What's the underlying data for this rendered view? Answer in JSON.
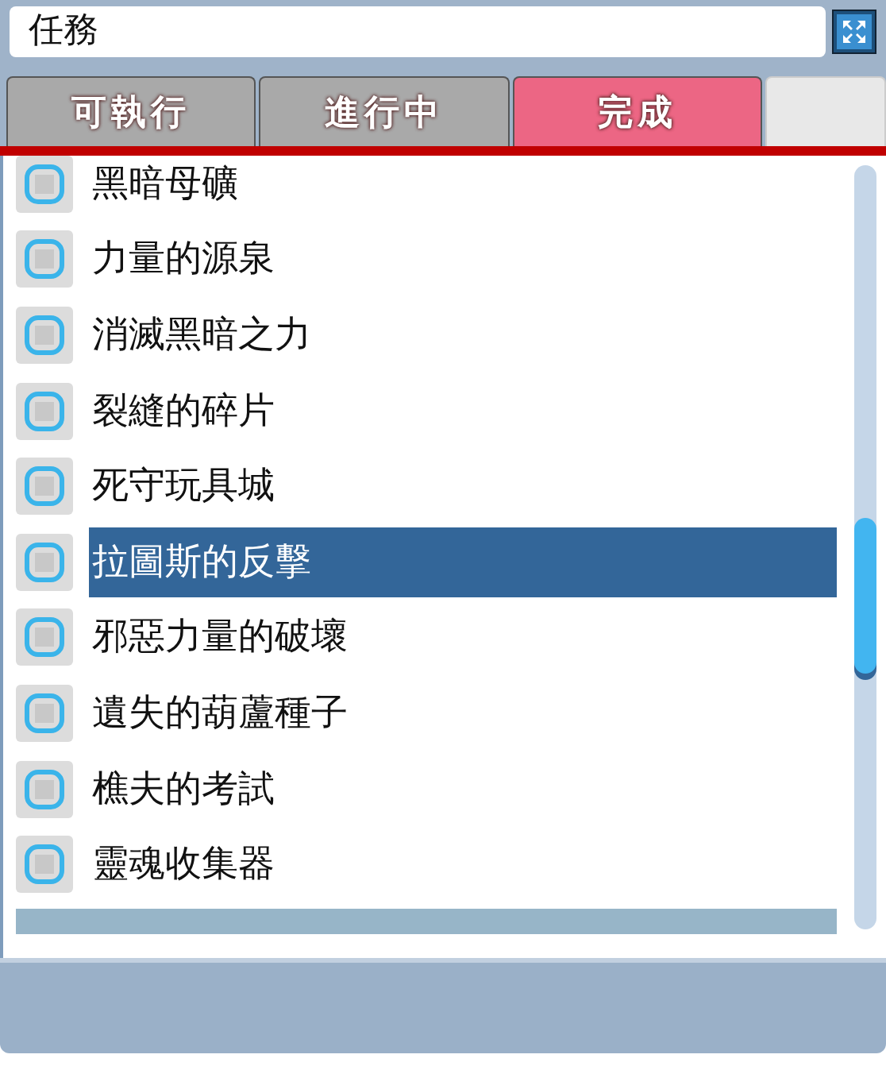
{
  "window": {
    "title": "任務"
  },
  "tabs": [
    {
      "label": "可執行",
      "selected": false
    },
    {
      "label": "進行中",
      "selected": false
    },
    {
      "label": "完成",
      "selected": true
    },
    {
      "selected": false
    }
  ],
  "quests": [
    {
      "name": "黑暗母礦",
      "selected": false
    },
    {
      "name": "力量的源泉",
      "selected": false
    },
    {
      "name": "消滅黑暗之力",
      "selected": false
    },
    {
      "name": "裂縫的碎片",
      "selected": false
    },
    {
      "name": "死守玩具城",
      "selected": false
    },
    {
      "name": "拉圖斯的反擊",
      "selected": true
    },
    {
      "name": "邪惡力量的破壞",
      "selected": false
    },
    {
      "name": "遺失的葫蘆種子",
      "selected": false
    },
    {
      "name": "樵夫的考試",
      "selected": false
    },
    {
      "name": "靈魂收集器",
      "selected": false
    }
  ]
}
